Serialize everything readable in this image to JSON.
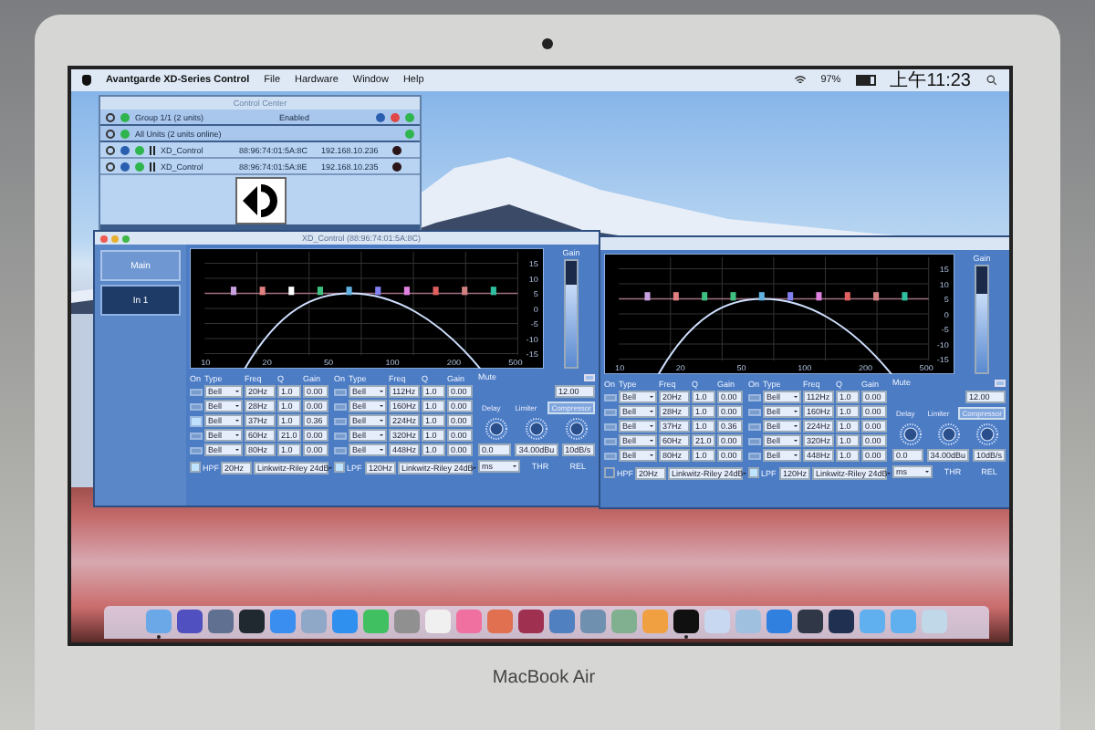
{
  "menu_bar": {
    "app": "Avantgarde XD-Series Control",
    "menus": [
      "File",
      "Hardware",
      "Window",
      "Help"
    ],
    "battery": "97%",
    "clock": "上午11:23"
  },
  "control_center": {
    "title": "Control Center",
    "group": {
      "name": "Group 1/1 (2 units)",
      "status": "Enabled"
    },
    "all_units": "All Units (2 units online)",
    "units": [
      {
        "name": "XD_Control",
        "mac": "88:96:74:01:5A:8C",
        "ip": "192.168.10.236"
      },
      {
        "name": "XD_Control",
        "mac": "88:96:74:01:5A:8E",
        "ip": "192.168.10.235"
      }
    ]
  },
  "xd_windows": [
    {
      "title": "XD_Control (88:96:74:01:5A:8C)",
      "tabs": [
        {
          "label": "Main",
          "selected": false
        },
        {
          "label": "In 1",
          "selected": true
        }
      ],
      "graph": {
        "y_ticks": [
          "15",
          "10",
          "5",
          "0",
          "-5",
          "-10",
          "-15"
        ],
        "x_ticks": [
          "10",
          "20",
          "50",
          "100",
          "200",
          "500"
        ]
      },
      "gain_label": "Gain",
      "level": 0.78,
      "band_tables": [
        {
          "headers": [
            "On",
            "Type",
            "Freq",
            "Q",
            "Gain"
          ],
          "bands": [
            {
              "on": false,
              "type": "Bell",
              "freq": "20Hz",
              "q": "1.0",
              "gain": "0.00",
              "color": "#c9a0e0"
            },
            {
              "on": false,
              "type": "Bell",
              "freq": "28Hz",
              "q": "1.0",
              "gain": "0.00",
              "color": "#e08080"
            },
            {
              "on": true,
              "type": "Bell",
              "freq": "37Hz",
              "q": "1.0",
              "gain": "0.36",
              "color": "#ffffff"
            },
            {
              "on": false,
              "type": "Bell",
              "freq": "60Hz",
              "q": "21.0",
              "gain": "0.00",
              "color": "#40c080"
            },
            {
              "on": false,
              "type": "Bell",
              "freq": "80Hz",
              "q": "1.0",
              "gain": "0.00",
              "color": "#60b0e0"
            }
          ]
        },
        {
          "headers": [
            "On",
            "Type",
            "Freq",
            "Q",
            "Gain"
          ],
          "bands": [
            {
              "on": false,
              "type": "Bell",
              "freq": "112Hz",
              "q": "1.0",
              "gain": "0.00",
              "color": "#8080f0"
            },
            {
              "on": false,
              "type": "Bell",
              "freq": "160Hz",
              "q": "1.0",
              "gain": "0.00",
              "color": "#e080e0"
            },
            {
              "on": false,
              "type": "Bell",
              "freq": "224Hz",
              "q": "1.0",
              "gain": "0.00",
              "color": "#e06060"
            },
            {
              "on": false,
              "type": "Bell",
              "freq": "320Hz",
              "q": "1.0",
              "gain": "0.00",
              "color": "#d08080"
            },
            {
              "on": false,
              "type": "Bell",
              "freq": "448Hz",
              "q": "1.0",
              "gain": "0.00",
              "color": "#30c0a0"
            }
          ]
        }
      ],
      "filters": [
        {
          "label": "HPF",
          "on": true,
          "freq": "20Hz",
          "slope": "Linkwitz-Riley 24dB"
        },
        {
          "label": "LPF",
          "on": true,
          "freq": "120Hz",
          "slope": "Linkwitz-Riley 24dB"
        }
      ],
      "mute_label": "Mute",
      "gain_value": "12.00",
      "dyn_tabs": [
        {
          "label": "Delay",
          "selected": false
        },
        {
          "label": "Limiter",
          "selected": false
        },
        {
          "label": "Compressor",
          "selected": true
        }
      ],
      "values": [
        "0.0",
        "34.00dBu",
        "10dB/s"
      ],
      "unit": "ms",
      "knob_labels": [
        "THR",
        "REL"
      ]
    },
    {
      "graph": {
        "y_ticks": [
          "15",
          "10",
          "5",
          "0",
          "-5",
          "-10",
          "-15"
        ],
        "x_ticks": [
          "10",
          "20",
          "50",
          "100",
          "200",
          "500"
        ]
      },
      "gain_label": "Gain",
      "level": 0.74,
      "band_tables": [
        {
          "headers": [
            "On",
            "Type",
            "Freq",
            "Q",
            "Gain"
          ],
          "bands": [
            {
              "on": false,
              "type": "Bell",
              "freq": "20Hz",
              "q": "1.0",
              "gain": "0.00",
              "color": "#c9a0e0"
            },
            {
              "on": false,
              "type": "Bell",
              "freq": "28Hz",
              "q": "1.0",
              "gain": "0.00",
              "color": "#e08080"
            },
            {
              "on": false,
              "type": "Bell",
              "freq": "37Hz",
              "q": "1.0",
              "gain": "0.36",
              "color": "#40c080"
            },
            {
              "on": false,
              "type": "Bell",
              "freq": "60Hz",
              "q": "21.0",
              "gain": "0.00",
              "color": "#40c080"
            },
            {
              "on": false,
              "type": "Bell",
              "freq": "80Hz",
              "q": "1.0",
              "gain": "0.00",
              "color": "#60b0e0"
            }
          ]
        },
        {
          "headers": [
            "On",
            "Type",
            "Freq",
            "Q",
            "Gain"
          ],
          "bands": [
            {
              "on": false,
              "type": "Bell",
              "freq": "112Hz",
              "q": "1.0",
              "gain": "0.00",
              "color": "#8080f0"
            },
            {
              "on": false,
              "type": "Bell",
              "freq": "160Hz",
              "q": "1.0",
              "gain": "0.00",
              "color": "#e080e0"
            },
            {
              "on": false,
              "type": "Bell",
              "freq": "224Hz",
              "q": "1.0",
              "gain": "0.00",
              "color": "#e06060"
            },
            {
              "on": false,
              "type": "Bell",
              "freq": "320Hz",
              "q": "1.0",
              "gain": "0.00",
              "color": "#d08080"
            },
            {
              "on": false,
              "type": "Bell",
              "freq": "448Hz",
              "q": "1.0",
              "gain": "0.00",
              "color": "#30c0a0"
            }
          ]
        }
      ],
      "filters": [
        {
          "label": "HPF",
          "on": false,
          "freq": "20Hz",
          "slope": "Linkwitz-Riley 24dB"
        },
        {
          "label": "LPF",
          "on": true,
          "freq": "120Hz",
          "slope": "Linkwitz-Riley 24dB"
        }
      ],
      "mute_label": "Mute",
      "gain_value": "12.00",
      "dyn_tabs": [
        {
          "label": "Delay",
          "selected": false
        },
        {
          "label": "Limiter",
          "selected": false
        },
        {
          "label": "Compressor",
          "selected": true
        }
      ],
      "values": [
        "0.0",
        "34.00dBu",
        "10dB/s"
      ],
      "unit": "ms",
      "knob_labels": [
        "THR",
        "REL"
      ]
    }
  ],
  "dock": {
    "icons": [
      {
        "color": "#6aa8e8",
        "running": true
      },
      {
        "color": "#5050c0",
        "running": false
      },
      {
        "color": "#607090",
        "running": false
      },
      {
        "color": "#202830",
        "running": false
      },
      {
        "color": "#3a8ef0",
        "running": false
      },
      {
        "color": "#90a8c8",
        "running": false
      },
      {
        "color": "#3090f0",
        "running": false
      },
      {
        "color": "#40c060",
        "running": false
      },
      {
        "color": "#909090",
        "running": false
      },
      {
        "color": "#f0f0f0",
        "running": false
      },
      {
        "color": "#f070a0",
        "running": false
      },
      {
        "color": "#e07050",
        "running": false
      },
      {
        "color": "#a03050",
        "running": false
      },
      {
        "color": "#5080c0",
        "running": false
      },
      {
        "color": "#7090b0",
        "running": false
      },
      {
        "color": "#80b090",
        "running": false
      },
      {
        "color": "#f0a040",
        "running": false
      },
      {
        "color": "#101010",
        "running": true
      },
      {
        "color": "#c8d8f0",
        "running": false
      },
      {
        "color": "#a0c0e0",
        "running": false
      },
      {
        "color": "#3080e0",
        "running": false
      },
      {
        "color": "#303848",
        "running": false
      },
      {
        "color": "#203050",
        "running": false
      },
      {
        "color": "#60b0f0",
        "running": false
      },
      {
        "color": "#60b0f0",
        "running": false
      },
      {
        "color": "#c0d8e8",
        "running": false
      }
    ]
  },
  "laptop_label": "MacBook Air"
}
